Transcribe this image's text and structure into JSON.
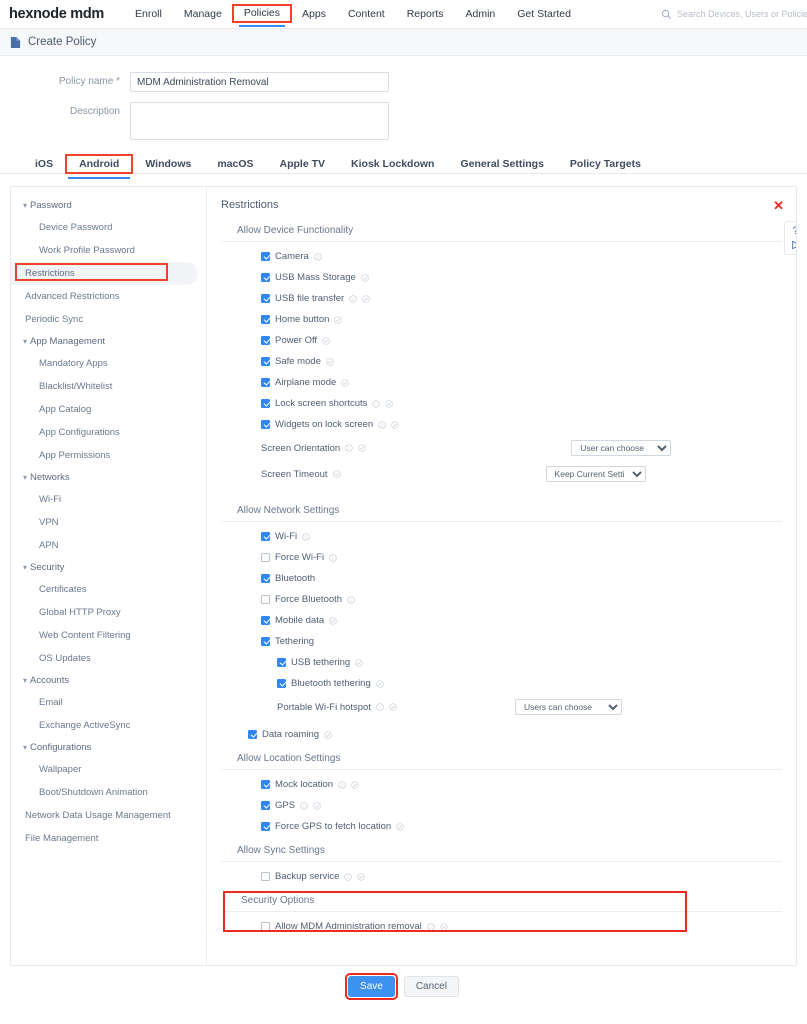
{
  "header": {
    "brand": "hexnode mdm",
    "nav": [
      {
        "label": "Enroll",
        "state": "normal"
      },
      {
        "label": "Manage",
        "state": "normal"
      },
      {
        "label": "Policies",
        "state": "highlighted-active"
      },
      {
        "label": "Apps",
        "state": "normal"
      },
      {
        "label": "Content",
        "state": "normal"
      },
      {
        "label": "Reports",
        "state": "normal"
      },
      {
        "label": "Admin",
        "state": "normal"
      },
      {
        "label": "Get Started",
        "state": "normal"
      }
    ],
    "search": {
      "placeholder": "Search Devices, Users or Policies",
      "icon": "search-icon"
    },
    "icons": [
      "bell-icon",
      "help-question-icon",
      "user-avatar"
    ]
  },
  "page": {
    "title": "Create Policy",
    "title_icon": "document-icon"
  },
  "form": {
    "policy_name_label": "Policy name *",
    "policy_name_value": "MDM Administration Removal",
    "policy_name_placeholder": "",
    "description_label": "Description",
    "description_value": "",
    "description_placeholder": ""
  },
  "platform_tabs": [
    {
      "label": "iOS",
      "selected": false
    },
    {
      "label": "Android",
      "selected": true
    },
    {
      "label": "Windows",
      "selected": false
    },
    {
      "label": "macOS",
      "selected": false
    },
    {
      "label": "Apple TV",
      "selected": false
    },
    {
      "label": "Kiosk Lockdown",
      "selected": false
    },
    {
      "label": "General Settings",
      "selected": false
    },
    {
      "label": "Policy Targets",
      "selected": false
    }
  ],
  "sidebar": {
    "entries": [
      {
        "label": "Password",
        "type": "group"
      },
      {
        "label": "Device Password",
        "type": "child"
      },
      {
        "label": "Work Profile Password",
        "type": "child"
      },
      {
        "label": "Restrictions",
        "type": "item",
        "selected": true
      },
      {
        "label": "Advanced Restrictions",
        "type": "item"
      },
      {
        "label": "Periodic Sync",
        "type": "item"
      },
      {
        "label": "App Management",
        "type": "group"
      },
      {
        "label": "Mandatory Apps",
        "type": "child"
      },
      {
        "label": "Blacklist/Whitelist",
        "type": "child"
      },
      {
        "label": "App Catalog",
        "type": "child"
      },
      {
        "label": "App Configurations",
        "type": "child"
      },
      {
        "label": "App Permissions",
        "type": "child"
      },
      {
        "label": "Networks",
        "type": "group"
      },
      {
        "label": "Wi-Fi",
        "type": "child"
      },
      {
        "label": "VPN",
        "type": "child"
      },
      {
        "label": "APN",
        "type": "child"
      },
      {
        "label": "Security",
        "type": "group"
      },
      {
        "label": "Certificates",
        "type": "child"
      },
      {
        "label": "Global HTTP Proxy",
        "type": "child"
      },
      {
        "label": "Web Content Filtering",
        "type": "child"
      },
      {
        "label": "OS Updates",
        "type": "child"
      },
      {
        "label": "Accounts",
        "type": "group"
      },
      {
        "label": "Email",
        "type": "child"
      },
      {
        "label": "Exchange ActiveSync",
        "type": "child"
      },
      {
        "label": "Configurations",
        "type": "group"
      },
      {
        "label": "Wallpaper",
        "type": "child"
      },
      {
        "label": "Boot/Shutdown Animation",
        "type": "child"
      },
      {
        "label": "Network Data Usage Management",
        "type": "item"
      },
      {
        "label": "File Management",
        "type": "item"
      }
    ]
  },
  "restrictions": {
    "title": "Restrictions",
    "close_icon": "close-x-icon",
    "help_icons": [
      "question-mark-icon",
      "play-video-icon"
    ],
    "sections": [
      {
        "header": "Allow Device Functionality",
        "options": [
          {
            "label": "Camera",
            "checked": true,
            "info": true,
            "badge": false
          },
          {
            "label": "USB Mass Storage",
            "checked": true,
            "info": false,
            "badge": true
          },
          {
            "label": "USB file transfer",
            "checked": true,
            "info": true,
            "badge": true
          },
          {
            "label": "Home button",
            "checked": true,
            "info": false,
            "badge": true
          },
          {
            "label": "Power Off",
            "checked": true,
            "info": false,
            "badge": true
          },
          {
            "label": "Safe mode",
            "checked": true,
            "info": false,
            "badge": true
          },
          {
            "label": "Airplane mode",
            "checked": true,
            "info": false,
            "badge": true
          },
          {
            "label": "Lock screen shortcuts",
            "checked": true,
            "info": true,
            "badge": true
          },
          {
            "label": "Widgets on lock screen",
            "checked": true,
            "info": true,
            "badge": true
          }
        ],
        "selects": [
          {
            "label": "Screen Orientation",
            "value": "User can choose",
            "info": true,
            "badge": true
          },
          {
            "label": "Screen Timeout",
            "value": "Keep Current Settings",
            "info": false,
            "badge": true
          }
        ]
      },
      {
        "header": "Allow Network Settings",
        "options": [
          {
            "label": "Wi-Fi",
            "checked": true,
            "info": true,
            "badge": false
          },
          {
            "label": "Force Wi-Fi",
            "checked": false,
            "info": true,
            "badge": false
          },
          {
            "label": "Bluetooth",
            "checked": true,
            "info": false,
            "badge": false
          },
          {
            "label": "Force Bluetooth",
            "checked": false,
            "info": true,
            "badge": false
          },
          {
            "label": "Mobile data",
            "checked": true,
            "info": false,
            "badge": true
          },
          {
            "label": "Tethering",
            "checked": true,
            "info": false,
            "badge": false
          }
        ],
        "indented_options": [
          {
            "label": "USB tethering",
            "checked": true,
            "info": false,
            "badge": true
          },
          {
            "label": "Bluetooth tethering",
            "checked": true,
            "info": false,
            "badge": true
          }
        ],
        "indented_selects": [
          {
            "label": "Portable Wi-Fi hotspot",
            "value": "Users can choose",
            "info": true,
            "badge": true
          }
        ],
        "trailing_options": [
          {
            "label": "Data roaming",
            "checked": true,
            "info": false,
            "badge": true
          }
        ]
      },
      {
        "header": "Allow Location Settings",
        "options": [
          {
            "label": "Mock location",
            "checked": true,
            "info": true,
            "badge": true
          },
          {
            "label": "GPS",
            "checked": true,
            "info": true,
            "badge": true
          },
          {
            "label": "Force GPS to fetch location",
            "checked": true,
            "info": false,
            "badge": true
          }
        ]
      },
      {
        "header": "Allow Sync Settings",
        "options": [
          {
            "label": "Backup service",
            "checked": false,
            "info": true,
            "badge": true
          }
        ]
      },
      {
        "header": "Security Options",
        "highlighted": true,
        "options": [
          {
            "label": "Allow MDM Administration removal",
            "checked": false,
            "info": true,
            "badge": true
          }
        ]
      }
    ]
  },
  "footer": {
    "save_label": "Save",
    "cancel_label": "Cancel"
  },
  "colors": {
    "accent_blue": "#2f86f2",
    "annotation_red": "#ee2b20",
    "text": "#4f5f74",
    "muted": "#8b97a6"
  }
}
